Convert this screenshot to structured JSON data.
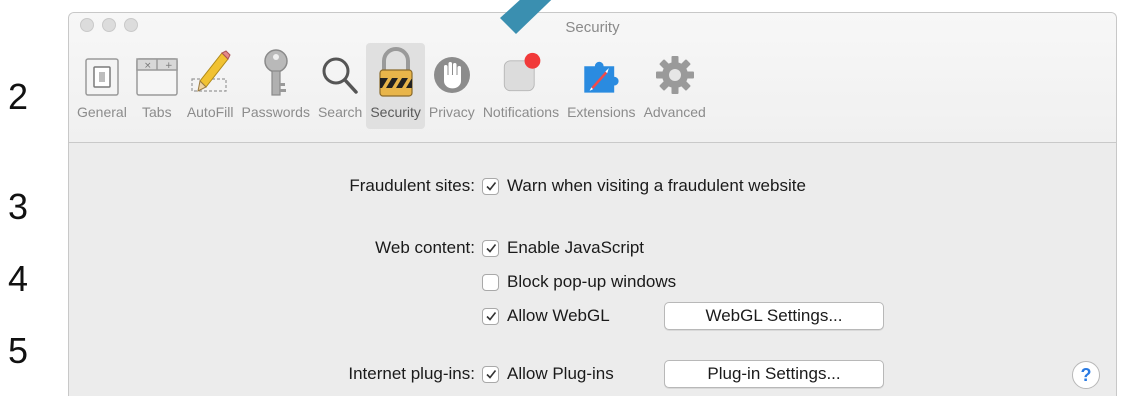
{
  "step_numbers": [
    "2",
    "3",
    "4",
    "5"
  ],
  "window": {
    "title": "Security"
  },
  "toolbar": {
    "items": [
      {
        "label": "General",
        "icon": "general-switch-icon"
      },
      {
        "label": "Tabs",
        "icon": "tabs-icon"
      },
      {
        "label": "AutoFill",
        "icon": "pencil-icon"
      },
      {
        "label": "Passwords",
        "icon": "key-icon"
      },
      {
        "label": "Search",
        "icon": "magnifier-icon"
      },
      {
        "label": "Security",
        "icon": "padlock-icon",
        "selected": true
      },
      {
        "label": "Privacy",
        "icon": "hand-icon"
      },
      {
        "label": "Notifications",
        "icon": "notification-badge-icon"
      },
      {
        "label": "Extensions",
        "icon": "puzzle-compass-icon"
      },
      {
        "label": "Advanced",
        "icon": "gear-icon"
      }
    ]
  },
  "settings": {
    "fraudulent_sites": {
      "label": "Fraudulent sites:",
      "option": "Warn when visiting a fraudulent website",
      "checked": true
    },
    "web_content": {
      "label": "Web content:",
      "javascript": {
        "option": "Enable JavaScript",
        "checked": true
      },
      "popups": {
        "option": "Block pop-up windows",
        "checked": false
      },
      "webgl": {
        "option": "Allow WebGL",
        "checked": true,
        "button": "WebGL Settings..."
      }
    },
    "plugins": {
      "label": "Internet plug-ins:",
      "option": "Allow Plug-ins",
      "checked": true,
      "button": "Plug-in Settings..."
    }
  },
  "help": {
    "label": "?"
  },
  "colors": {
    "accent": "#2a7ae2",
    "pointer": "#3a8fb0",
    "window_bg": "#ececec"
  }
}
